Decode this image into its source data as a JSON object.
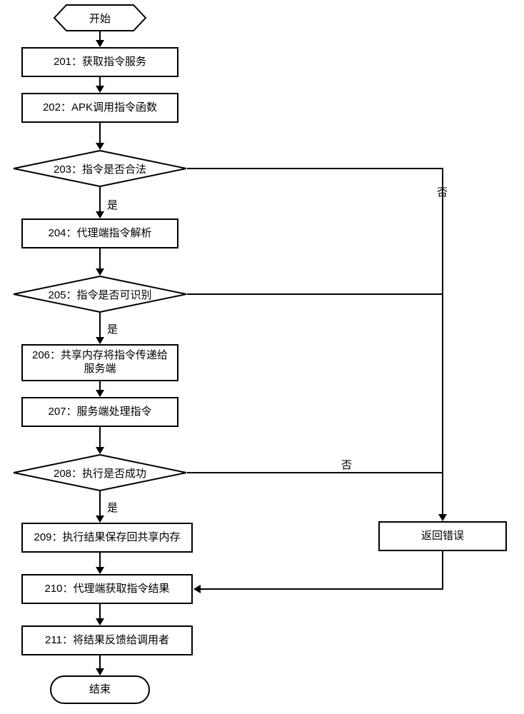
{
  "nodes": {
    "start": "开始",
    "s201": "201：获取指令服务",
    "s202": "202：APK调用指令函数",
    "d203": "203：指令是否合法",
    "s204": "204：代理端指令解析",
    "d205": "205：指令是否可识别",
    "s206": "206：共享内存将指令传递给服务端",
    "s207": "207：服务端处理指令",
    "d208": "208：执行是否成功",
    "s209": "209：执行结果保存回共享内存",
    "s210": "210：代理端获取指令结果",
    "s211": "211：将结果反馈给调用者",
    "err": "返回错误",
    "end": "结束"
  },
  "labels": {
    "yes": "是",
    "no": "否"
  }
}
